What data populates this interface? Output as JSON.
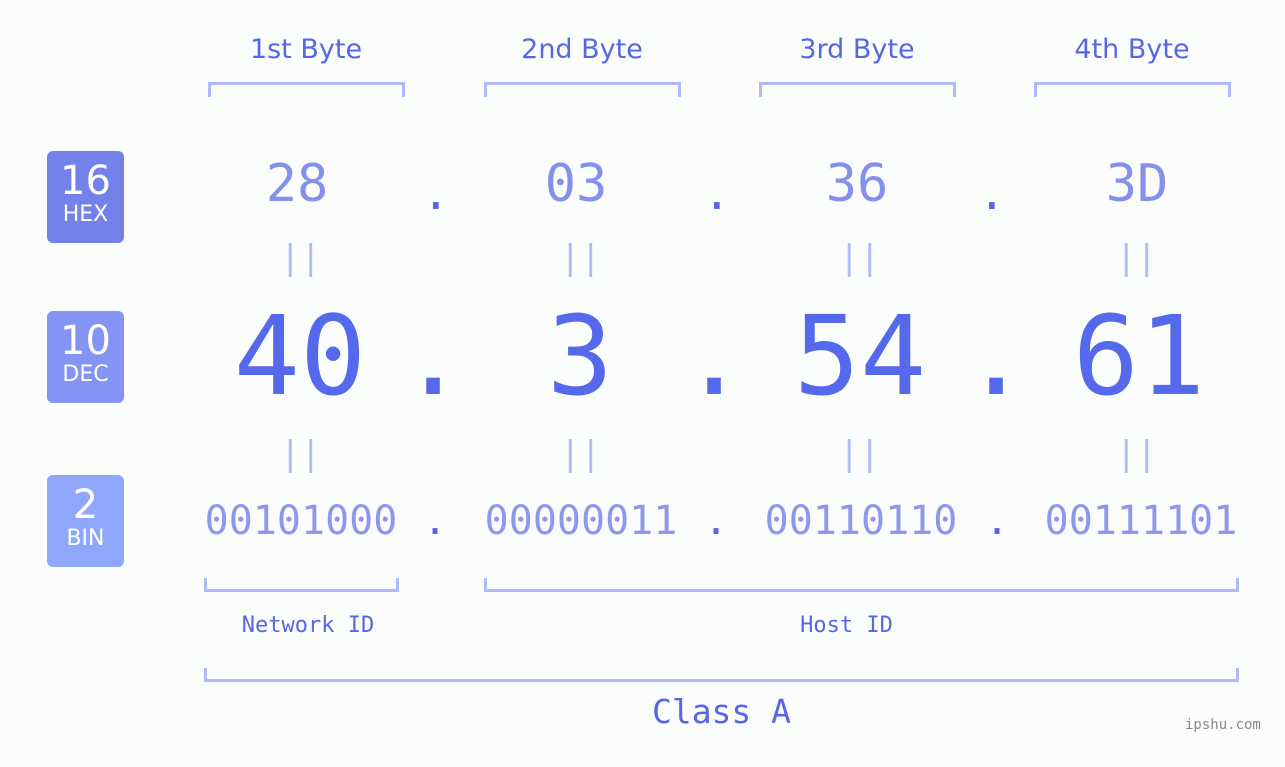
{
  "byte_headers": [
    "1st Byte",
    "2nd Byte",
    "3rd Byte",
    "4th Byte"
  ],
  "badges": {
    "hex": {
      "base": "16",
      "label": "HEX",
      "color": "#7581ea"
    },
    "dec": {
      "base": "10",
      "label": "DEC",
      "color": "#8593f2"
    },
    "bin": {
      "base": "2",
      "label": "BIN",
      "color": "#8fa8fb"
    }
  },
  "hex_values": [
    "28",
    "03",
    "36",
    "3D"
  ],
  "dec_values": [
    "40",
    "3",
    "54",
    "61"
  ],
  "bin_values": [
    "00101000",
    "00000011",
    "00110110",
    "00111101"
  ],
  "separator": ".",
  "equals": "||",
  "network_label": "Network ID",
  "host_label": "Host ID",
  "class_label": "Class A",
  "watermark": "ipshu.com",
  "colors": {
    "accent": "#5469ec",
    "bracket": "#b1baf8"
  }
}
